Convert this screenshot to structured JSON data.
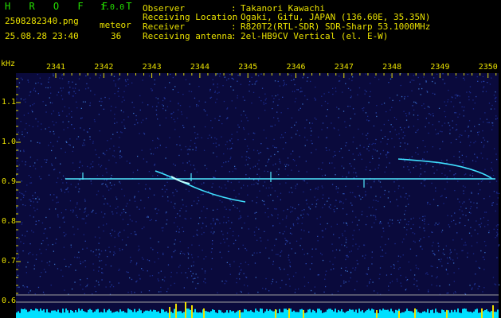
{
  "header": {
    "logo": "H R O F F T",
    "version": "1.0.0",
    "filename": "2508282340.png",
    "datetime": "25.08.28 23:40",
    "meteor_label": "meteor",
    "meteor_count": "36",
    "info": [
      {
        "label": "Observer",
        "value": "Takanori Kawachi"
      },
      {
        "label": "Receiving Location",
        "value": "Ogaki, Gifu, JAPAN (136.60E, 35.35N)"
      },
      {
        "label": "Receiver",
        "value": "R820T2(RTL-SDR) SDR-Sharp 53.1000MHz"
      },
      {
        "label": "Receiving antenna",
        "value": "2el-HB9CV Vertical (el. E-W)"
      }
    ]
  },
  "axis": {
    "unit": "kHz",
    "time_ticks": [
      "2341",
      "2342",
      "2343",
      "2344",
      "2345",
      "2346",
      "2347",
      "2348",
      "2349",
      "2350"
    ],
    "freq_ticks": [
      "1.1",
      "1.0",
      "0.9",
      "0.8",
      "0.7",
      "0.6"
    ]
  },
  "colors": {
    "header_text": "#e8e000",
    "logo": "#25e000",
    "background": "#0a0a3c",
    "echo": "#40e0ff",
    "noise_bar": "#00e0ff",
    "noise_peak": "#f0e000"
  }
}
